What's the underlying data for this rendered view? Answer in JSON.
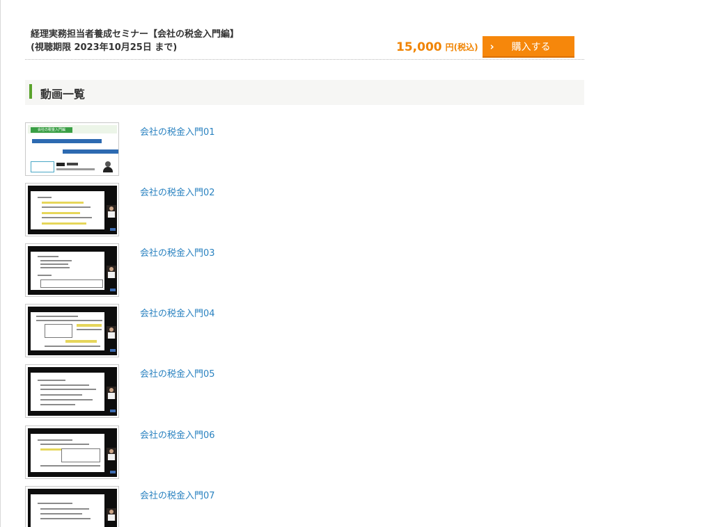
{
  "product": {
    "title_line1": "経理実務担当者養成セミナー【会社の税金入門編】",
    "title_line2": "(視聴期限 2023年10月25日 まで)",
    "price": "15,000",
    "price_unit": "円(税込)",
    "buy_label": "購入する",
    "buy_icon": "chevron-right-icon",
    "accent_color": "#f08300"
  },
  "section": {
    "title": "動画一覧",
    "bar_color": "#5aa32c"
  },
  "thumb_card": {
    "tag": "会社の税金入門編"
  },
  "videos": [
    {
      "title": "会社の税金入門01",
      "thumb": "title-card"
    },
    {
      "title": "会社の税金入門02",
      "thumb": "lecture-screen"
    },
    {
      "title": "会社の税金入門03",
      "thumb": "lecture-screen"
    },
    {
      "title": "会社の税金入門04",
      "thumb": "lecture-screen"
    },
    {
      "title": "会社の税金入門05",
      "thumb": "lecture-screen"
    },
    {
      "title": "会社の税金入門06",
      "thumb": "lecture-screen"
    },
    {
      "title": "会社の税金入門07",
      "thumb": "lecture-screen"
    }
  ],
  "link_color": "#2a82c0"
}
